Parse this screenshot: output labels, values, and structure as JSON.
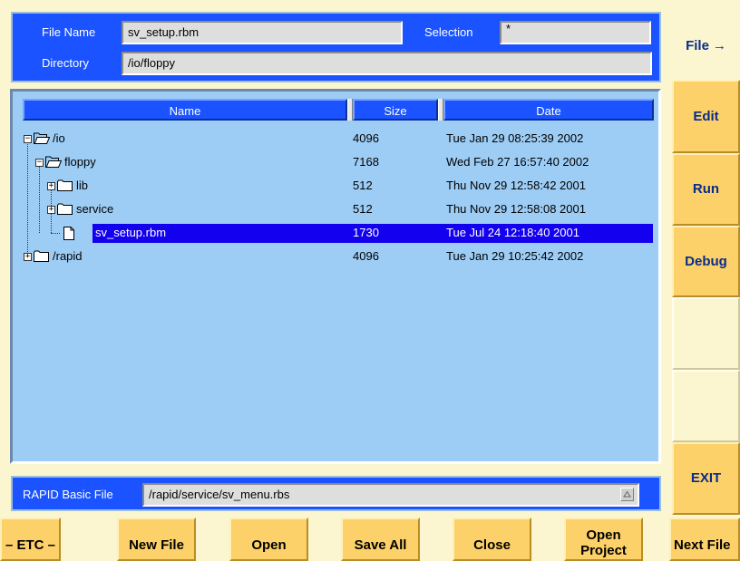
{
  "header": {
    "file_name_label": "File Name",
    "file_name_value": "sv_setup.rbm",
    "selection_label": "Selection",
    "selection_value": "*",
    "directory_label": "Directory",
    "directory_value": "/io/floppy"
  },
  "file_list": {
    "columns": [
      "Name",
      "Size",
      "Date"
    ],
    "rows": [
      {
        "name": "/io",
        "size": "4096",
        "date": "Tue Jan 29 08:25:39 2002",
        "kind": "folder-open",
        "expander": "minus"
      },
      {
        "name": "floppy",
        "size": "7168",
        "date": "Wed Feb 27 16:57:40 2002",
        "kind": "folder-open",
        "expander": "minus"
      },
      {
        "name": "lib",
        "size": "512",
        "date": "Thu Nov 29 12:58:42 2001",
        "kind": "folder",
        "expander": "plus"
      },
      {
        "name": "service",
        "size": "512",
        "date": "Thu Nov 29 12:58:08 2001",
        "kind": "folder",
        "expander": "plus"
      },
      {
        "name": "sv_setup.rbm",
        "size": "1730",
        "date": "Tue Jul 24 12:18:40 2001",
        "kind": "file",
        "selected": true
      },
      {
        "name": "/rapid",
        "size": "4096",
        "date": "Tue Jan 29 10:25:42 2002",
        "kind": "folder",
        "expander": "plus"
      }
    ]
  },
  "rapid_basic": {
    "label": "RAPID Basic File",
    "value": "/rapid/service/sv_menu.rbs"
  },
  "side_menu": {
    "file": "File",
    "edit": "Edit",
    "run": "Run",
    "debug": "Debug",
    "exit": "EXIT"
  },
  "bottom_buttons": {
    "etc": "– ETC –",
    "new_file": "New File",
    "open": "Open",
    "save_all": "Save All",
    "close": "Close",
    "open_project_1": "Open",
    "open_project_2": "Project",
    "next_file": "Next File"
  },
  "colors": {
    "panel_blue": "#1a53ff",
    "list_bg": "#9dcdf5",
    "selection": "#1300ee",
    "button": "#fdd16a",
    "background": "#fbf6cf",
    "button_text": "#082c8a"
  },
  "icons": [
    "folder-open-icon",
    "folder-icon",
    "file-icon",
    "tree-expand-icon",
    "tree-collapse-icon",
    "arrow-icon"
  ]
}
